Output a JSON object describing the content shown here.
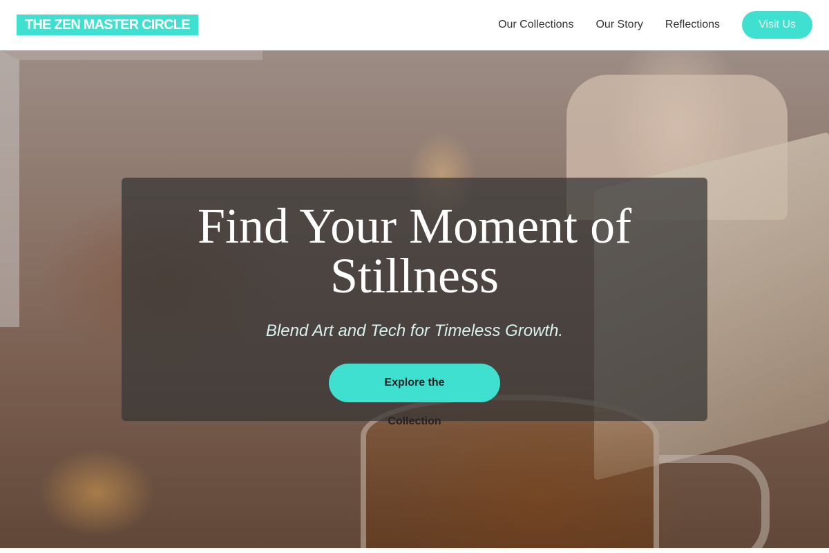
{
  "header": {
    "logo": "THE ZEN MASTER CIRCLE",
    "nav": [
      {
        "label": "Our Collections"
      },
      {
        "label": "Our Story"
      },
      {
        "label": "Reflections"
      }
    ],
    "cta_label": "Visit Us"
  },
  "hero": {
    "headline": "Find Your Moment of Stillness",
    "subtitle": "Blend Art and Tech for Timeless Growth.",
    "button_label": "Explore the Collection"
  },
  "colors": {
    "accent": "#40e0d0",
    "panel": "#343434",
    "headline": "#ffffff"
  }
}
